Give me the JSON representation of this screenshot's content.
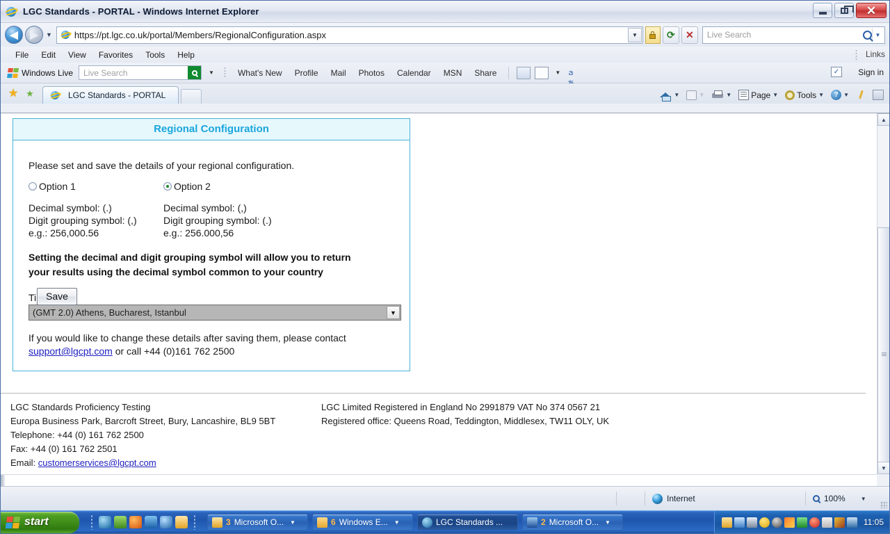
{
  "window": {
    "title": "LGC Standards - PORTAL - Windows Internet Explorer",
    "minimize_label": "Minimize",
    "restore_label": "Restore",
    "close_label": "Close"
  },
  "address_bar": {
    "url": "https://pt.lgc.co.uk/portal/Members/RegionalConfiguration.aspx",
    "back_label": "Back",
    "forward_label": "Forward",
    "refresh_label": "Refresh",
    "stop_label": "Stop",
    "lock_label": "Security Report",
    "search_placeholder": "Live Search"
  },
  "menu": {
    "items": [
      "File",
      "Edit",
      "View",
      "Favorites",
      "Tools",
      "Help"
    ],
    "links_label": "Links"
  },
  "live_toolbar": {
    "brand": "Windows Live",
    "search_placeholder": "Live Search",
    "links": [
      "What's New",
      "Profile",
      "Mail",
      "Photos",
      "Calendar",
      "MSN",
      "Share"
    ],
    "sign_in": "Sign in"
  },
  "tabs": {
    "favorites_label": "Favorites Center",
    "add_favorite_label": "Add to Favorites",
    "items": [
      {
        "label": "LGC Standards - PORTAL"
      }
    ],
    "new_tab_label": "New Tab"
  },
  "command_bar": {
    "home": "Home",
    "feeds": "Feeds",
    "print": "Print",
    "page": "Page",
    "tools": "Tools",
    "help": "Help",
    "pen": "Edit",
    "research": "Research"
  },
  "panel": {
    "title": "Regional Configuration",
    "lead": "Please set and save the details of your regional configuration.",
    "options": [
      {
        "label": "Option 1",
        "selected": false,
        "decimal": "Decimal symbol: (.)",
        "grouping": "Digit grouping symbol: (,)",
        "example": "e.g.: 256,000.56"
      },
      {
        "label": "Option 2",
        "selected": true,
        "decimal": "Decimal symbol: (,)",
        "grouping": "Digit grouping symbol: (.)",
        "example": "e.g.: 256.000,56"
      }
    ],
    "note_line1": "Setting the decimal and digit grouping symbol will allow you to return",
    "note_line2": "your results using the decimal symbol common to your country",
    "timezone_label": "Time Zone",
    "timezone_value": "(GMT 2.0) Athens, Bucharest, Istanbul",
    "save_label": "Save",
    "contact_line1_a": "If you would like to change these details after saving them, please contact",
    "contact_email": "support@lgcpt.com",
    "contact_line2_b": " or call +44 (0)161 762 2500"
  },
  "footer": {
    "left": [
      "LGC Standards Proficiency Testing",
      "Europa Business Park, Barcroft Street, Bury, Lancashire, BL9 5BT",
      "Telephone: +44 (0) 161 762 2500",
      "Fax: +44 (0) 161 762 2501"
    ],
    "email_prefix": "Email: ",
    "email": "customerservices@lgcpt.com",
    "right": [
      "LGC Limited Registered in England No 2991879 VAT No 374 0567 21",
      "Registered office: Queens Road, Teddington, Middlesex, TW11 OLY, UK"
    ]
  },
  "status_bar": {
    "zone": "Internet",
    "zoom": "100%"
  },
  "taskbar": {
    "start": "start",
    "tasks": [
      {
        "count": "3",
        "label": "Microsoft O...",
        "active": false,
        "color": "#f0c24a"
      },
      {
        "count": "6",
        "label": "Windows E...",
        "active": false,
        "color": "#f2c05c"
      },
      {
        "count": "",
        "label": "LGC Standards ...",
        "active": true,
        "color": "#2f8fd4"
      },
      {
        "count": "2",
        "label": "Microsoft O...",
        "active": false,
        "color": "#2b5fa8"
      }
    ],
    "clock": "11:05"
  },
  "colors": {
    "panel_border": "#4ab4d4",
    "panel_header_bg": "#e7f8fd",
    "panel_title": "#1aa6dd",
    "link": "#2020c0",
    "radio_dot": "#1f8b2a",
    "taskbar_blue": "#1f56ad",
    "start_green": "#3c8a18"
  }
}
